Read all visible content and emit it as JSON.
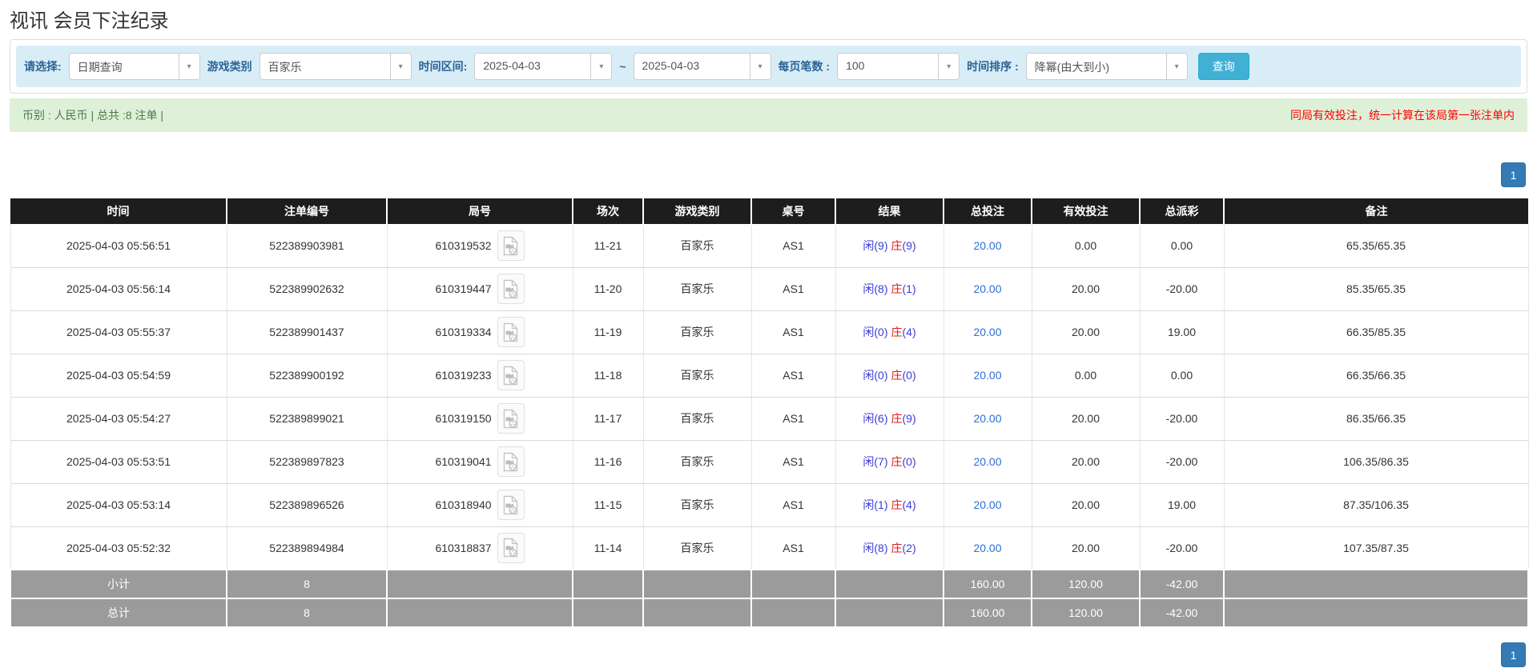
{
  "page": {
    "title": "视讯 会员下注纪录"
  },
  "colors": {
    "filter_bg": "#d9edf7",
    "filter_label_blue": "#2a6496",
    "search_button_cyan": "#41b0d5",
    "summary_bg": "#dff0d8",
    "summary_text_green": "#4a7d4a",
    "notice_red": "#ff0000",
    "header_bg": "#1d1d1d",
    "footer_gray": "#9b9b9b",
    "pager_blue": "#337ab7",
    "link_blue": "#2a6fdb",
    "player_blue": "#3b3bd9",
    "banker_red": "#e01919",
    "negative_red": "#ff0000"
  },
  "filters": {
    "query_type_label": "请选择:",
    "query_type_value": "日期查询",
    "game_type_label": "游戏类别",
    "game_type_value": "百家乐",
    "time_range_label": "时间区间:",
    "date_from": "2025-04-03",
    "range_separator": "~",
    "date_to": "2025-04-03",
    "page_size_label": "每页笔数 :",
    "page_size_value": "100",
    "sort_label": "时间排序 :",
    "sort_value": "降幂(由大到小)",
    "search_button_label": "查询",
    "caret_glyph": "▾"
  },
  "summary": {
    "left_text": "币别 : 人民币 | 总共 :8 注单 |",
    "right_text": "同局有效投注，统一计算在该局第一张注单内"
  },
  "pagination": {
    "current_page": "1"
  },
  "table": {
    "headers": [
      "时间",
      "注单编号",
      "局号",
      "场次",
      "游戏类别",
      "桌号",
      "结果",
      "总投注",
      "有效投注",
      "总派彩",
      "备注"
    ],
    "rows": [
      {
        "time": "2025-04-03 05:56:51",
        "bet_id": "522389903981",
        "round_id": "610319532",
        "session": "11-21",
        "game": "百家乐",
        "table_no": "AS1",
        "result_xian": "闲(9)",
        "result_zhuang": "庄",
        "result_zhuang_pts": "(9)",
        "total_bet": "20.00",
        "valid_bet": "0.00",
        "payout": "0.00",
        "remark": "65.35/65.35"
      },
      {
        "time": "2025-04-03 05:56:14",
        "bet_id": "522389902632",
        "round_id": "610319447",
        "session": "11-20",
        "game": "百家乐",
        "table_no": "AS1",
        "result_xian": "闲(8)",
        "result_zhuang": "庄",
        "result_zhuang_pts": "(1)",
        "total_bet": "20.00",
        "valid_bet": "20.00",
        "payout": "-20.00",
        "remark": "85.35/65.35"
      },
      {
        "time": "2025-04-03 05:55:37",
        "bet_id": "522389901437",
        "round_id": "610319334",
        "session": "11-19",
        "game": "百家乐",
        "table_no": "AS1",
        "result_xian": "闲(0)",
        "result_zhuang": "庄",
        "result_zhuang_pts": "(4)",
        "total_bet": "20.00",
        "valid_bet": "20.00",
        "payout": "19.00",
        "remark": "66.35/85.35"
      },
      {
        "time": "2025-04-03 05:54:59",
        "bet_id": "522389900192",
        "round_id": "610319233",
        "session": "11-18",
        "game": "百家乐",
        "table_no": "AS1",
        "result_xian": "闲(0)",
        "result_zhuang": "庄",
        "result_zhuang_pts": "(0)",
        "total_bet": "20.00",
        "valid_bet": "0.00",
        "payout": "0.00",
        "remark": "66.35/66.35"
      },
      {
        "time": "2025-04-03 05:54:27",
        "bet_id": "522389899021",
        "round_id": "610319150",
        "session": "11-17",
        "game": "百家乐",
        "table_no": "AS1",
        "result_xian": "闲(6)",
        "result_zhuang": "庄",
        "result_zhuang_pts": "(9)",
        "total_bet": "20.00",
        "valid_bet": "20.00",
        "payout": "-20.00",
        "remark": "86.35/66.35"
      },
      {
        "time": "2025-04-03 05:53:51",
        "bet_id": "522389897823",
        "round_id": "610319041",
        "session": "11-16",
        "game": "百家乐",
        "table_no": "AS1",
        "result_xian": "闲(7)",
        "result_zhuang": "庄",
        "result_zhuang_pts": "(0)",
        "total_bet": "20.00",
        "valid_bet": "20.00",
        "payout": "-20.00",
        "remark": "106.35/86.35"
      },
      {
        "time": "2025-04-03 05:53:14",
        "bet_id": "522389896526",
        "round_id": "610318940",
        "session": "11-15",
        "game": "百家乐",
        "table_no": "AS1",
        "result_xian": "闲(1)",
        "result_zhuang": "庄",
        "result_zhuang_pts": "(4)",
        "total_bet": "20.00",
        "valid_bet": "20.00",
        "payout": "19.00",
        "remark": "87.35/106.35"
      },
      {
        "time": "2025-04-03 05:52:32",
        "bet_id": "522389894984",
        "round_id": "610318837",
        "session": "11-14",
        "game": "百家乐",
        "table_no": "AS1",
        "result_xian": "闲(8)",
        "result_zhuang": "庄",
        "result_zhuang_pts": "(2)",
        "total_bet": "20.00",
        "valid_bet": "20.00",
        "payout": "-20.00",
        "remark": "107.35/87.35"
      }
    ],
    "subtotal": {
      "label": "小计",
      "count": "8",
      "total_bet": "160.00",
      "valid_bet": "120.00",
      "payout": "-42.00",
      "remark": ""
    },
    "total": {
      "label": "总计",
      "count": "8",
      "total_bet": "160.00",
      "valid_bet": "120.00",
      "payout": "-42.00",
      "remark": ""
    }
  }
}
